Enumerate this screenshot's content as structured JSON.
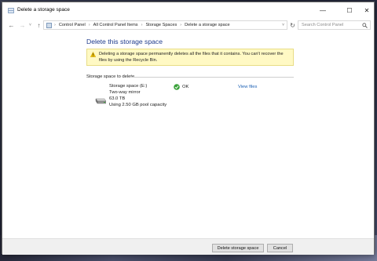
{
  "window": {
    "title": "Delete a storage space"
  },
  "titlebar": {
    "minimize_glyph": "—",
    "maximize_glyph": "☐",
    "close_glyph": "✕"
  },
  "nav": {
    "back_glyph": "←",
    "forward_glyph": "→",
    "recent_glyph": "˅",
    "up_glyph": "↑",
    "refresh_glyph": "↻"
  },
  "address": {
    "crumbs": [
      "Control Panel",
      "All Control Panel Items",
      "Storage Spaces",
      "Delete a storage space"
    ],
    "separator": "›",
    "dropdown_glyph": "˅"
  },
  "search": {
    "placeholder": "Search Control Panel"
  },
  "main": {
    "heading": "Delete this storage space",
    "warning": "Deleting a storage space permanently deletes all the files that it contains. You can't recover the files by using the Recycle Bin.",
    "section_label": "Storage space to delete",
    "space": {
      "name": "Storage space (E:)",
      "type": "Two-way mirror",
      "size": "63.0 TB",
      "usage": "Using 2.50 GB pool capacity",
      "status": "OK",
      "view_files": "View files"
    }
  },
  "footer": {
    "delete_label": "Delete storage space",
    "cancel_label": "Cancel"
  },
  "icons": {
    "window": "storage-spaces-icon",
    "warning": "warning-icon",
    "ok": "ok-check-icon",
    "drive": "drive-icon",
    "search": "search-icon"
  },
  "colors": {
    "heading": "#1f3b8c",
    "warning_bg": "#fff9c4",
    "ok_green": "#3aa23a",
    "link": "#1a5fb4"
  }
}
